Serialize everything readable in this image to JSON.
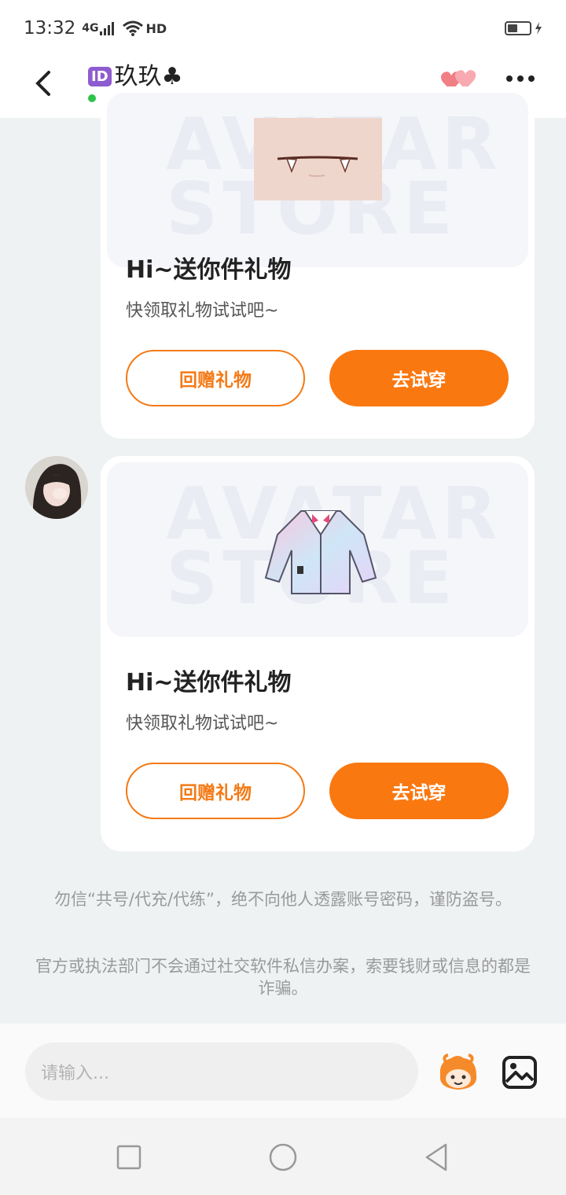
{
  "status_bar": {
    "time": "13:32",
    "signal": "4G",
    "network": "HD"
  },
  "header": {
    "id_badge": "ID",
    "contact_name": "玖玖♣",
    "online_status": "在线",
    "cp_badge": "CP"
  },
  "cards": [
    {
      "title": "Hi~送你件礼物",
      "subtitle": "快领取礼物试试吧~",
      "return_gift_label": "回赠礼物",
      "try_on_label": "去试穿",
      "watermark": "AVATAR STORE"
    },
    {
      "title": "Hi~送你件礼物",
      "subtitle": "快领取礼物试试吧~",
      "return_gift_label": "回赠礼物",
      "try_on_label": "去试穿",
      "watermark": "AVATAR STORE"
    }
  ],
  "notices": [
    "勿信“共号/代充/代练”，绝不向他人透露账号密码，谨防盗号。",
    "官方或执法部门不会通过社交软件私信办案，索要钱财或信息的都是诈骗。"
  ],
  "input": {
    "placeholder": "请输入..."
  },
  "colors": {
    "accent": "#fa7810",
    "online": "#2fc34a",
    "cp_badge": "#a44ed6"
  }
}
